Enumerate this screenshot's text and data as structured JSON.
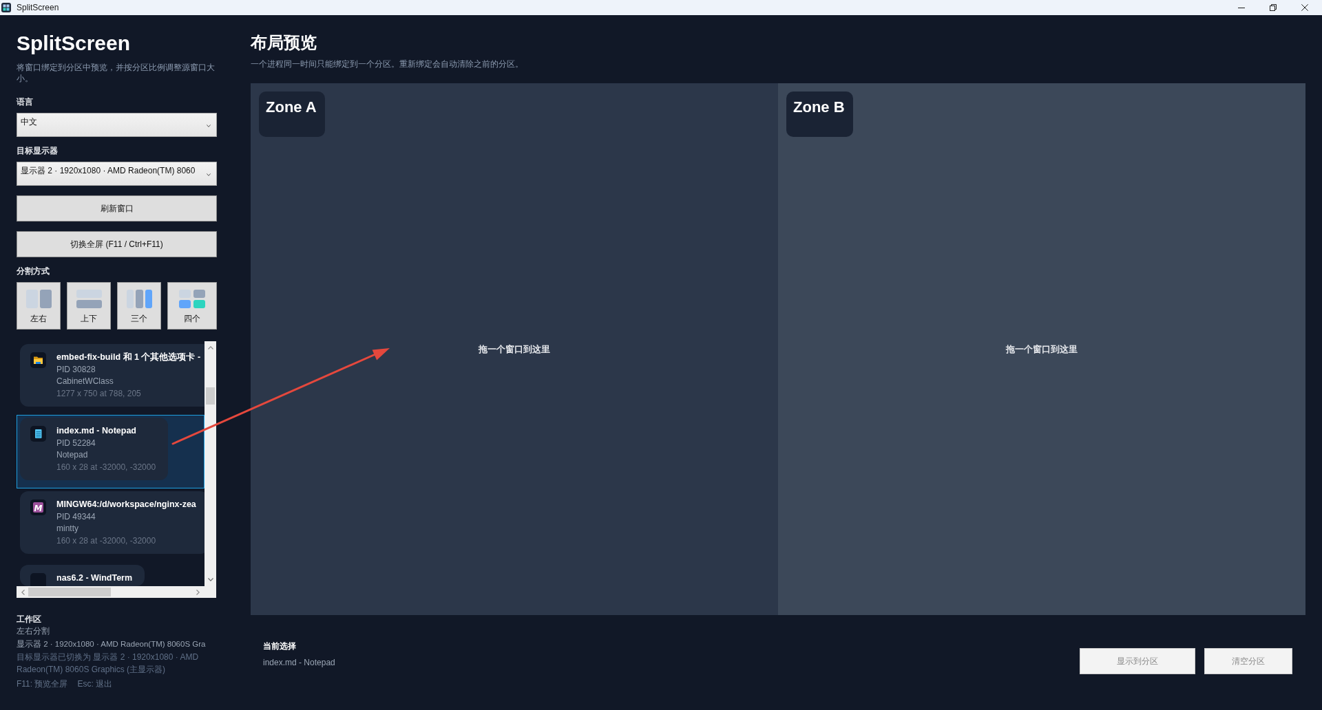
{
  "window": {
    "title": "SplitScreen",
    "controls": [
      {
        "kind": "minimize"
      },
      {
        "kind": "restore"
      },
      {
        "kind": "close"
      }
    ]
  },
  "sidebar": {
    "title": "SplitScreen",
    "description": "将窗口绑定到分区中预览，并按分区比例调整源窗口大小。",
    "language": {
      "label": "语言",
      "value": "中文"
    },
    "monitor": {
      "label": "目标显示器",
      "value": "显示器 2 · 1920x1080 · AMD Radeon(TM) 8060"
    },
    "actions": [
      {
        "label": "刷新窗口",
        "disabled": false
      },
      {
        "label": "切换全屏 (F11 / Ctrl+F11)",
        "disabled": false
      }
    ],
    "split_label": "分割方式",
    "layouts": [
      {
        "label": "左右",
        "kind": "columns"
      },
      {
        "label": "上下",
        "kind": "rows"
      },
      {
        "label": "三个",
        "kind": "three"
      },
      {
        "label": "四个",
        "kind": "grid"
      }
    ],
    "windows": [
      {
        "title": "embed-fix-build 和 1 个其他选项卡 -",
        "pid": "PID 30828",
        "class_name": "CabinetWClass",
        "geometry": "1277 x 750 at 788, 205",
        "kind": "folder",
        "selected": false
      },
      {
        "title": "index.md - Notepad",
        "pid": "PID 52284",
        "class_name": "Notepad",
        "geometry": "160 x 28 at -32000, -32000",
        "kind": "notepad",
        "selected": true
      },
      {
        "title": "MINGW64:/d/workspace/nginx-zea",
        "pid": "PID 49344",
        "class_name": "mintty",
        "geometry": "160 x 28 at -32000, -32000",
        "kind": "letter",
        "icon_text": "M",
        "selected": false
      },
      {
        "title": "nas6.2 - WindTerm",
        "kind": "blank",
        "selected": false
      }
    ],
    "workspace": {
      "heading": "工作区",
      "layout": "左右分割",
      "monitor": "显示器 2 · 1920x1080 · AMD Radeon(TM) 8060S Gra",
      "status": "目标显示器已切换为 显示器 2 · 1920x1080 · AMD Radeon(TM) 8060S Graphics (主显示器)",
      "hints": [
        "F11: 预览全屏",
        "Esc: 退出"
      ]
    }
  },
  "main": {
    "title": "布局预览",
    "subtitle": "一个进程同一时间只能绑定到一个分区。重新绑定会自动清除之前的分区。",
    "zones": [
      {
        "label": "Zone A",
        "hint": "拖一个窗口到这里",
        "color": "#2c374a"
      },
      {
        "label": "Zone B",
        "hint": "拖一个窗口到这里",
        "color": "#3c4859"
      }
    ],
    "current": {
      "label": "当前选择",
      "value": "index.md - Notepad"
    },
    "buttons": [
      {
        "label": "显示到分区",
        "disabled": true
      },
      {
        "label": "清空分区",
        "disabled": true
      }
    ]
  },
  "annotation": {
    "kind": "arrow"
  }
}
